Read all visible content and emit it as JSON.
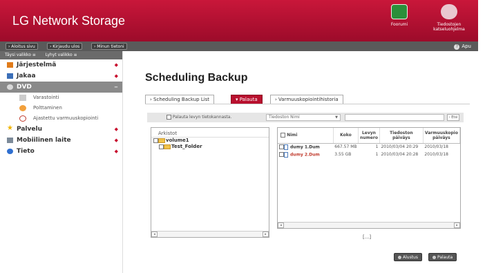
{
  "app": {
    "title": "LG Network Storage"
  },
  "header": {
    "forum_label": "Foorumi",
    "manual_label": "Tiedostojen katseluohjelma"
  },
  "topnav": {
    "home": "› Aloitus sivu",
    "logout": "› Kirjaudu ulos",
    "myinfo": "› Minun tietoni",
    "help": "Apu"
  },
  "sidebar": {
    "tabs": [
      "Täysi valikko ≡",
      "Lyhyt valikko ≡"
    ],
    "items": [
      {
        "label": "Järjestelmä",
        "icon": "system-icon",
        "color": "#e07b1a"
      },
      {
        "label": "Jakaa",
        "icon": "share-icon",
        "color": "#3b6fb8"
      },
      {
        "label": "DVD",
        "icon": "dvd-icon",
        "color": "#ffffff",
        "active": true
      },
      {
        "label": "Palvelu",
        "icon": "star-icon",
        "color": "#f0b400"
      },
      {
        "label": "Mobiilinen laite",
        "icon": "device-icon",
        "color": "#7c8a99"
      },
      {
        "label": "Tieto",
        "icon": "info-icon",
        "color": "#2f6fd0"
      }
    ],
    "dvd_sub": [
      "Varastointi",
      "Polttaminen",
      "Ajastettu varmuuskopiointi"
    ]
  },
  "main": {
    "title": "Scheduling Backup",
    "tabs": [
      "› Scheduling Backup List",
      "▾ Palauta",
      "› Varmuuskopiointihistoria"
    ],
    "search": {
      "check_label": "Palauta levyn tietokannasta.",
      "select_value": "Tiedoston Nimi",
      "find_label": "› Etsi"
    },
    "tree": {
      "header": "Arkistot",
      "nodes": [
        "volume1",
        "Test_Folder"
      ]
    },
    "files": {
      "columns": [
        "Nimi",
        "Koko",
        "Levyn numero",
        "Tiedoston päiväys",
        "Varmuuskopio päiväys"
      ],
      "rows": [
        {
          "name": "dumy 1.Dum",
          "size": "667.57 MB",
          "disk": "1",
          "file_date": "2010/03/04 20:29",
          "backup_date": "2010/03/18"
        },
        {
          "name": "dumy 2.Dum",
          "size": "3.55 GB",
          "disk": "1",
          "file_date": "2010/03/04 20:28",
          "backup_date": "2010/03/18"
        }
      ]
    },
    "pager": "[...]",
    "buttons": {
      "reset": "Alustus",
      "restore": "Palauta"
    }
  },
  "colors": {
    "header": "#b3122f",
    "accent": "#b8102e",
    "bar": "#5a5a5a"
  }
}
